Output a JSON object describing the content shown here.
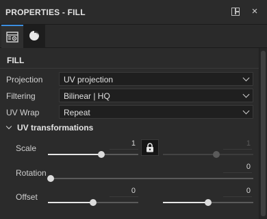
{
  "panel": {
    "title": "PROPERTIES - FILL"
  },
  "tabs": [
    {
      "name": "properties",
      "active": true
    },
    {
      "name": "environment",
      "active": false
    }
  ],
  "section": {
    "title": "FILL"
  },
  "fields": {
    "projection": {
      "label": "Projection",
      "value": "UV projection"
    },
    "filtering": {
      "label": "Filtering",
      "value": "Bilinear | HQ"
    },
    "uv_wrap": {
      "label": "UV Wrap",
      "value": "Repeat"
    }
  },
  "uv_transformations": {
    "title": "UV transformations",
    "scale": {
      "label": "Scale",
      "value_u": "1",
      "value_v": "1",
      "fraction_u": 0.59,
      "fraction_v": 0.59,
      "locked": true
    },
    "rotation": {
      "label": "Rotation",
      "value": "0",
      "fraction": 0.0
    },
    "offset": {
      "label": "Offset",
      "value_u": "0",
      "value_v": "0",
      "fraction_u": 0.5,
      "fraction_v": 0.5
    }
  },
  "colors": {
    "accent": "#3d8fe0",
    "background": "#2b2b2b",
    "field_bg": "#1f1f1f"
  },
  "icons": {
    "split_view": "split-view-icon",
    "close": "close-icon",
    "lock": "lock-icon"
  }
}
